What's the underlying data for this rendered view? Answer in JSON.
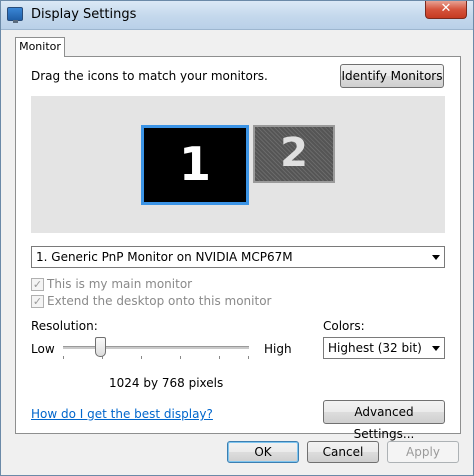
{
  "window": {
    "title": "Display Settings"
  },
  "tabs": [
    {
      "label": "Monitor"
    }
  ],
  "monitor_tab": {
    "instruction": "Drag the icons to match your monitors.",
    "identify_button": "Identify Monitors",
    "monitors": [
      {
        "number": "1",
        "selected": true
      },
      {
        "number": "2",
        "selected": false
      }
    ],
    "monitor_select": "1. Generic PnP Monitor on NVIDIA MCP67M",
    "main_monitor_checkbox": {
      "label": "This is my main monitor",
      "checked": true,
      "enabled": false
    },
    "extend_checkbox": {
      "label": "Extend the desktop onto this monitor",
      "checked": true,
      "enabled": false
    },
    "resolution": {
      "label": "Resolution:",
      "low_label": "Low",
      "high_label": "High",
      "value_text": "1024 by 768 pixels",
      "slider_level": 0.2
    },
    "colors": {
      "label": "Colors:",
      "selected": "Highest (32 bit)"
    },
    "help_link": "How do I get the best display?",
    "advanced_button": "Advanced Settings..."
  },
  "footer": {
    "ok_label": "OK",
    "cancel_label": "Cancel",
    "apply_label": "Apply"
  },
  "colors_theme": {
    "selection_border": "#3c94e6",
    "close_button": "#c53b22",
    "link": "#0066cc"
  }
}
